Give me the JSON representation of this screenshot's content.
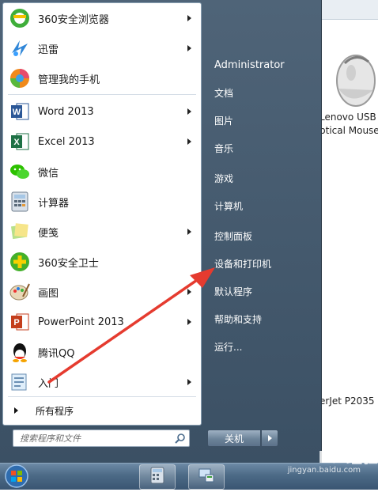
{
  "left_pane": {
    "programs": [
      {
        "label": "360安全浏览器",
        "icon": "360-browser-icon",
        "has_submenu": true
      },
      {
        "label": "迅雷",
        "icon": "xunlei-icon",
        "has_submenu": true
      },
      {
        "label": "管理我的手机",
        "icon": "phone-manager-icon",
        "has_submenu": false
      },
      {
        "label": "Word 2013",
        "icon": "word-icon",
        "has_submenu": true
      },
      {
        "label": "Excel 2013",
        "icon": "excel-icon",
        "has_submenu": true
      },
      {
        "label": "微信",
        "icon": "wechat-icon",
        "has_submenu": false
      },
      {
        "label": "计算器",
        "icon": "calculator-icon",
        "has_submenu": false
      },
      {
        "label": "便笺",
        "icon": "sticky-notes-icon",
        "has_submenu": true
      },
      {
        "label": "360安全卫士",
        "icon": "360-security-icon",
        "has_submenu": false
      },
      {
        "label": "画图",
        "icon": "paint-icon",
        "has_submenu": true
      },
      {
        "label": "PowerPoint 2013",
        "icon": "powerpoint-icon",
        "has_submenu": true
      },
      {
        "label": "腾讯QQ",
        "icon": "qq-icon",
        "has_submenu": false
      },
      {
        "label": "入门",
        "icon": "getting-started-icon",
        "has_submenu": true
      }
    ],
    "all_programs": "所有程序",
    "search_placeholder": "搜索程序和文件"
  },
  "right_pane": {
    "user": "Administrator",
    "items": [
      "文档",
      "图片",
      "音乐",
      "游戏",
      "计算机",
      "控制面板",
      "设备和打印机",
      "默认程序",
      "帮助和支持",
      "运行..."
    ],
    "shutdown": "关机"
  },
  "desktop": {
    "device1_line1": "Lenovo USB",
    "device1_line2": "ptical Mouse",
    "device2": "erJet P2035"
  },
  "watermark": {
    "brand": "Bai",
    "brand2": "经验",
    "url": "jingyan.baidu.com"
  },
  "colors": {
    "menu_blue": "#4f6478",
    "word_blue": "#2b5797",
    "excel_green": "#1e7145",
    "ppt_orange": "#c43e1c",
    "arrow_red": "#e53b2f"
  }
}
